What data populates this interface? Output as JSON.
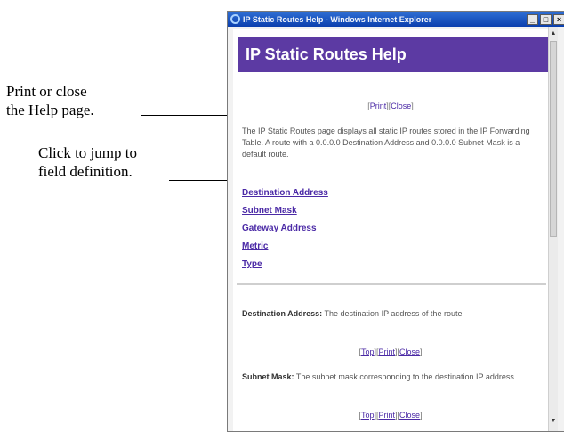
{
  "annotations": {
    "print_close_line1": "Print or close",
    "print_close_line2": "the Help page.",
    "jump_line1": "Click to jump to",
    "jump_line2": "field definition."
  },
  "window": {
    "title": "IP Static Routes Help - Windows Internet Explorer",
    "min_glyph": "_",
    "max_glyph": "□",
    "close_glyph": "×"
  },
  "page": {
    "heading": "IP Static Routes Help",
    "nav_top": {
      "open": "[",
      "print": "Print",
      "sep": "][",
      "close": "Close",
      "end": "]"
    },
    "intro": "The IP Static Routes page displays all static IP routes stored in the IP Forwarding Table. A route with a 0.0.0.0 Destination Address and 0.0.0.0 Subnet Mask is a default route.",
    "field_links": [
      "Destination Address",
      "Subnet Mask",
      "Gateway Address",
      "Metric",
      "Type"
    ],
    "definitions": [
      {
        "term": "Destination Address:",
        "text": " The destination IP address of the route"
      },
      {
        "term": "Subnet Mask:",
        "text": " The subnet mask corresponding to the destination IP address"
      }
    ],
    "nav_section": {
      "open": "[",
      "top": "Top",
      "sep1": "][",
      "print": "Print",
      "sep2": "][",
      "close": "Close",
      "end": "]"
    }
  }
}
